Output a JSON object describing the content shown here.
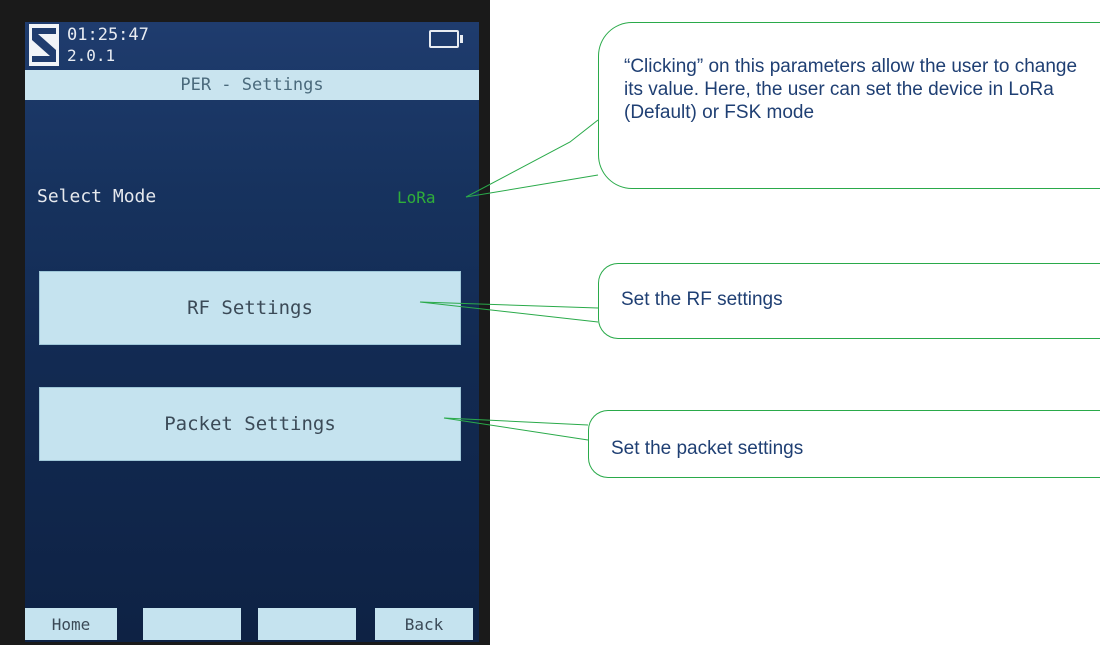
{
  "status_bar": {
    "time": "01:25:47",
    "version": "2.0.1",
    "battery_icon": "battery-icon",
    "logo_icon": "s-logo-icon"
  },
  "header": {
    "title": "PER - Settings"
  },
  "mode": {
    "label": "Select Mode",
    "value": "LoRa"
  },
  "buttons": {
    "rf": "RF Settings",
    "packet": "Packet Settings"
  },
  "soft_keys": {
    "left": "Home",
    "key2": "",
    "key3": "",
    "right": "Back"
  },
  "callouts": {
    "mode": "“Clicking” on this parameters allow the user to change its value. Here, the user can set the device in LoRa (Default) or FSK mode",
    "rf": "Set the RF settings",
    "packet": "Set the packet settings"
  },
  "colors": {
    "screen_bg": "#17335f",
    "button_bg": "#c5e3ef",
    "mode_value": "#2fae3a",
    "callout_border": "#2aaa4a",
    "callout_text": "#1f3f73"
  }
}
